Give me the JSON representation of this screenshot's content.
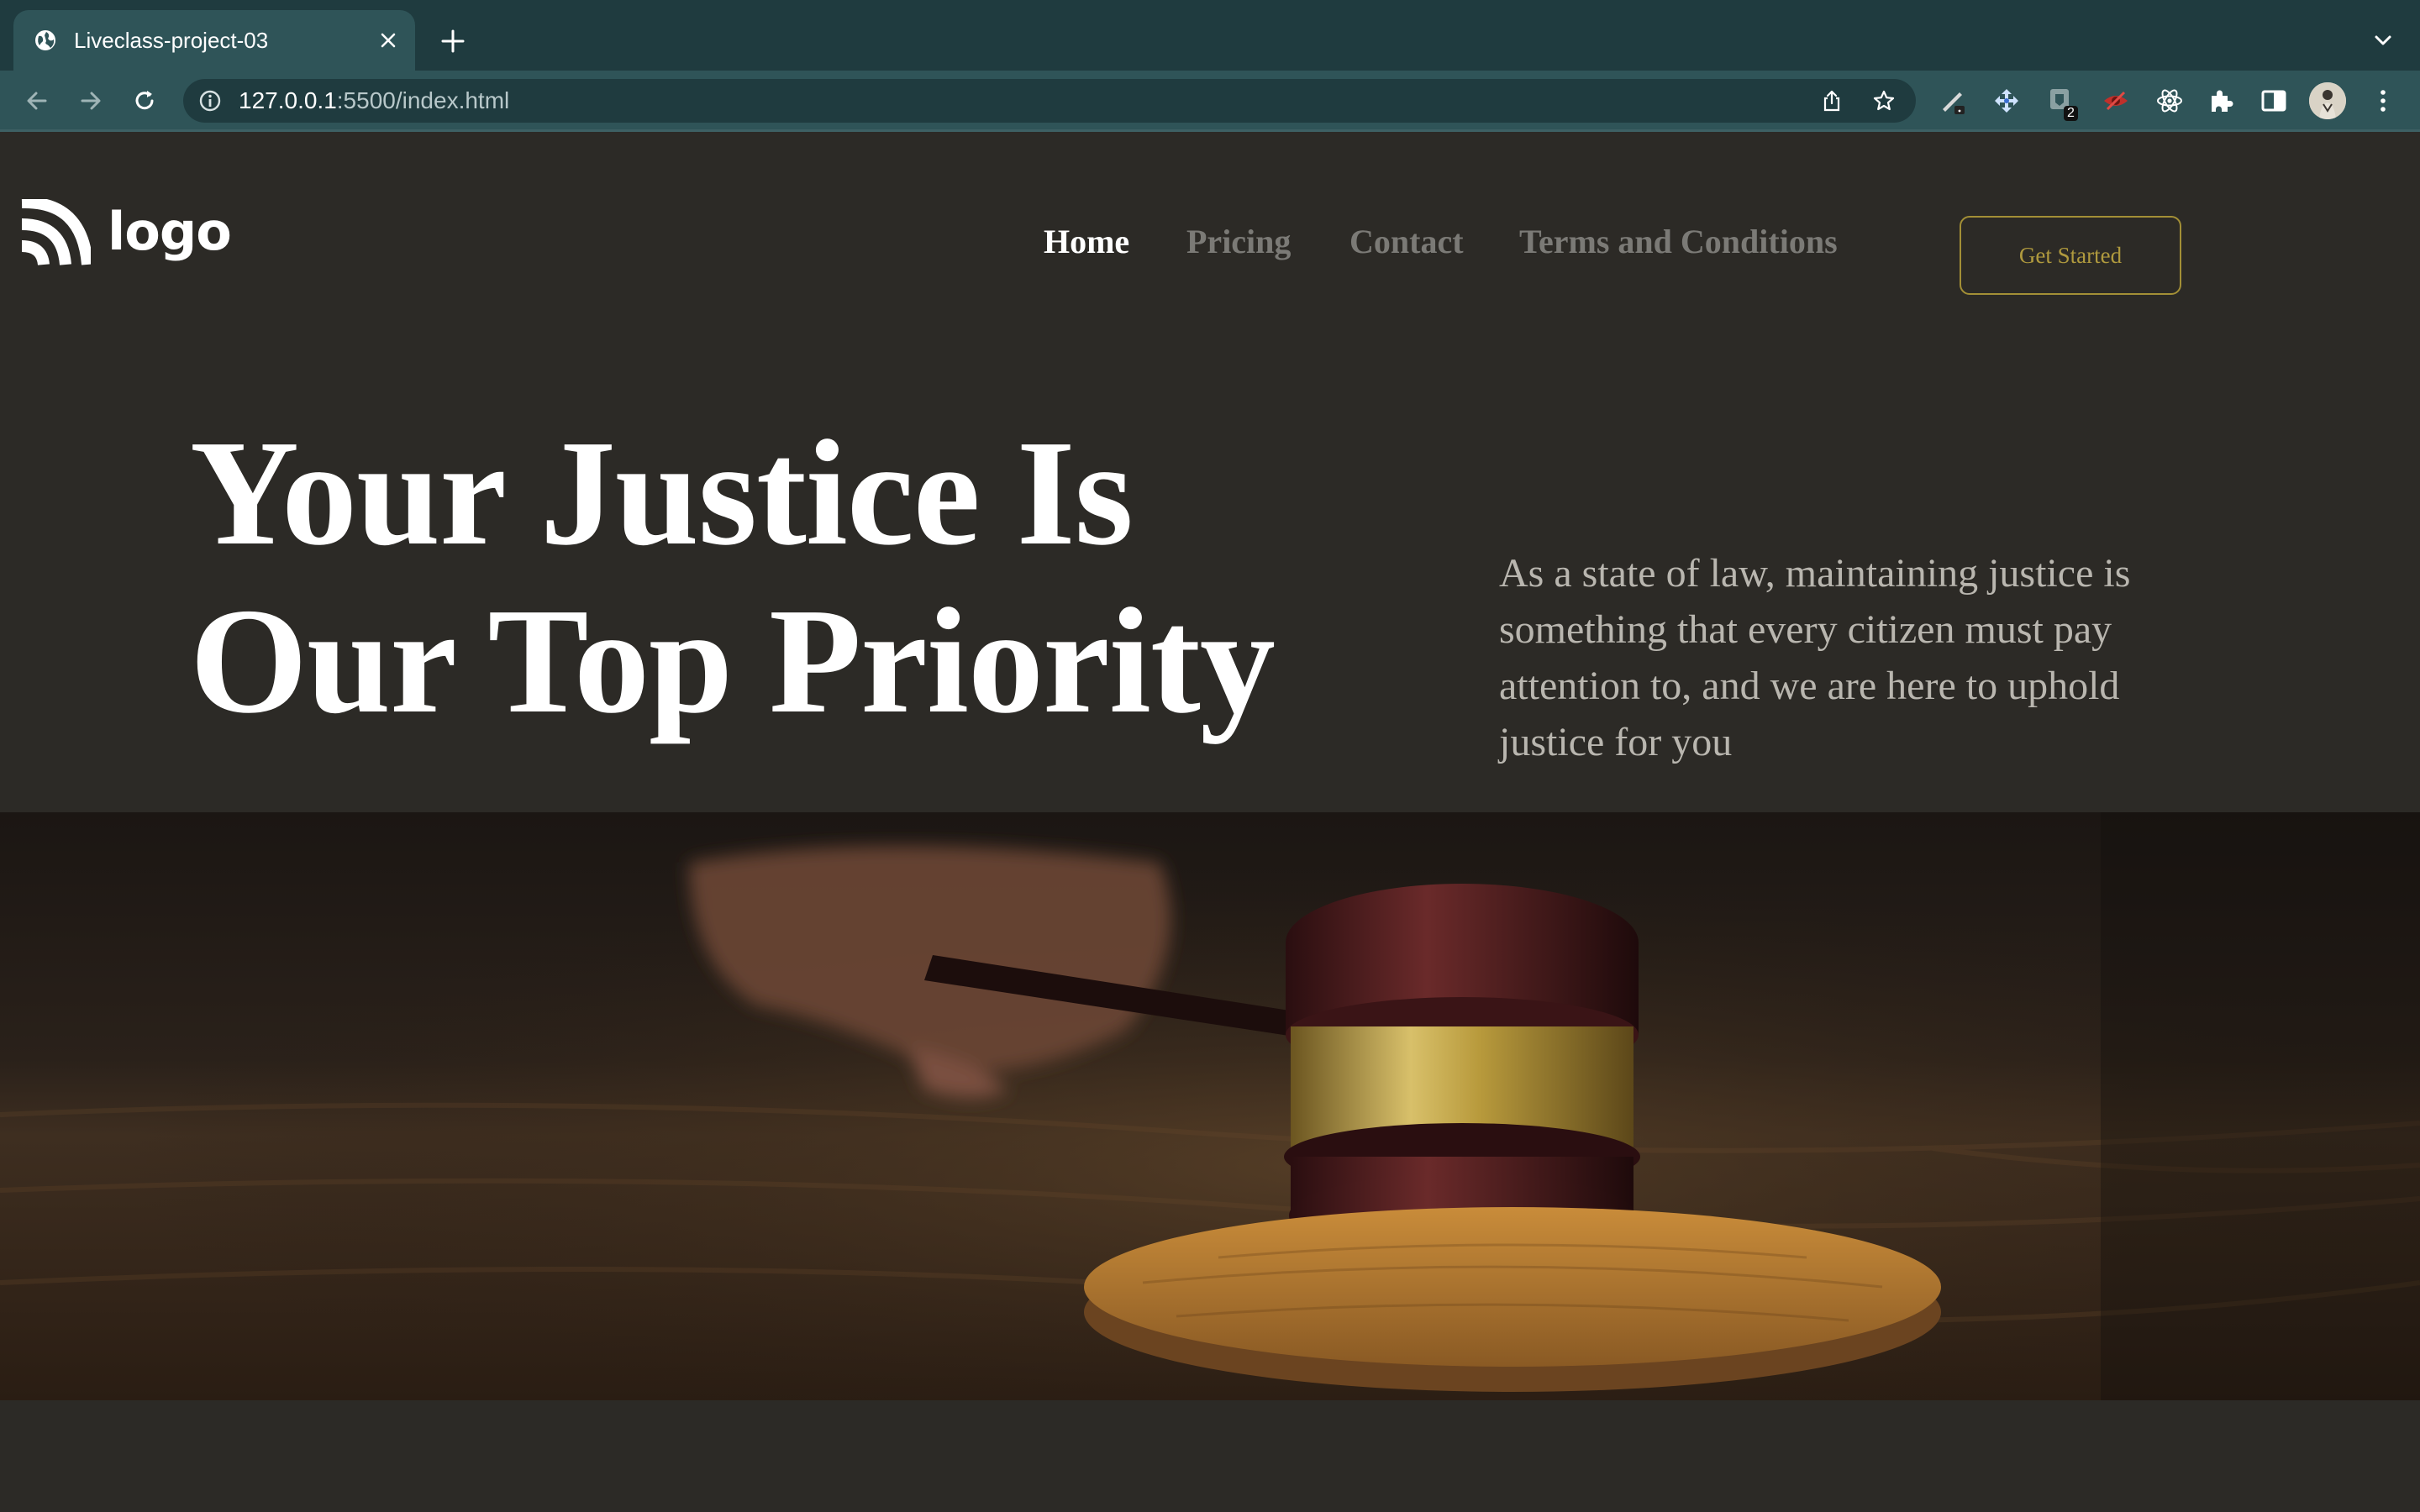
{
  "browser": {
    "tab_title": "Liveclass-project-03",
    "url_host": "127.0.0.1",
    "url_rest": ":5500/index.html",
    "extension_badge": "2",
    "icons": [
      "globe-icon",
      "close-icon",
      "plus-icon",
      "chevron-down-icon",
      "back-arrow-icon",
      "forward-arrow-icon",
      "reload-icon",
      "info-icon",
      "share-icon",
      "star-icon",
      "pen-extension-icon",
      "move-extension-icon",
      "shield-extension-icon",
      "eye-extension-icon",
      "react-extension-icon",
      "puzzle-icon",
      "side-panel-icon",
      "kebab-menu-icon"
    ]
  },
  "site": {
    "logo_text": "logo",
    "nav": [
      "Home",
      "Pricing",
      "Contact",
      "Terms and Conditions"
    ],
    "cta_label": "Get Started",
    "hero_title_line1": "Your Justice Is",
    "hero_title_line2": "Our Top Priority",
    "hero_subtitle": "As a state of law, maintaining justice is something that every citizen must pay attention to, and we are here to uphold justice for you",
    "colors": {
      "background": "#2c2a26",
      "accent_gold": "#a38f36",
      "nav_muted": "#7b7a76",
      "chrome_dark": "#1f3b3f",
      "chrome_light": "#2f5458"
    }
  }
}
